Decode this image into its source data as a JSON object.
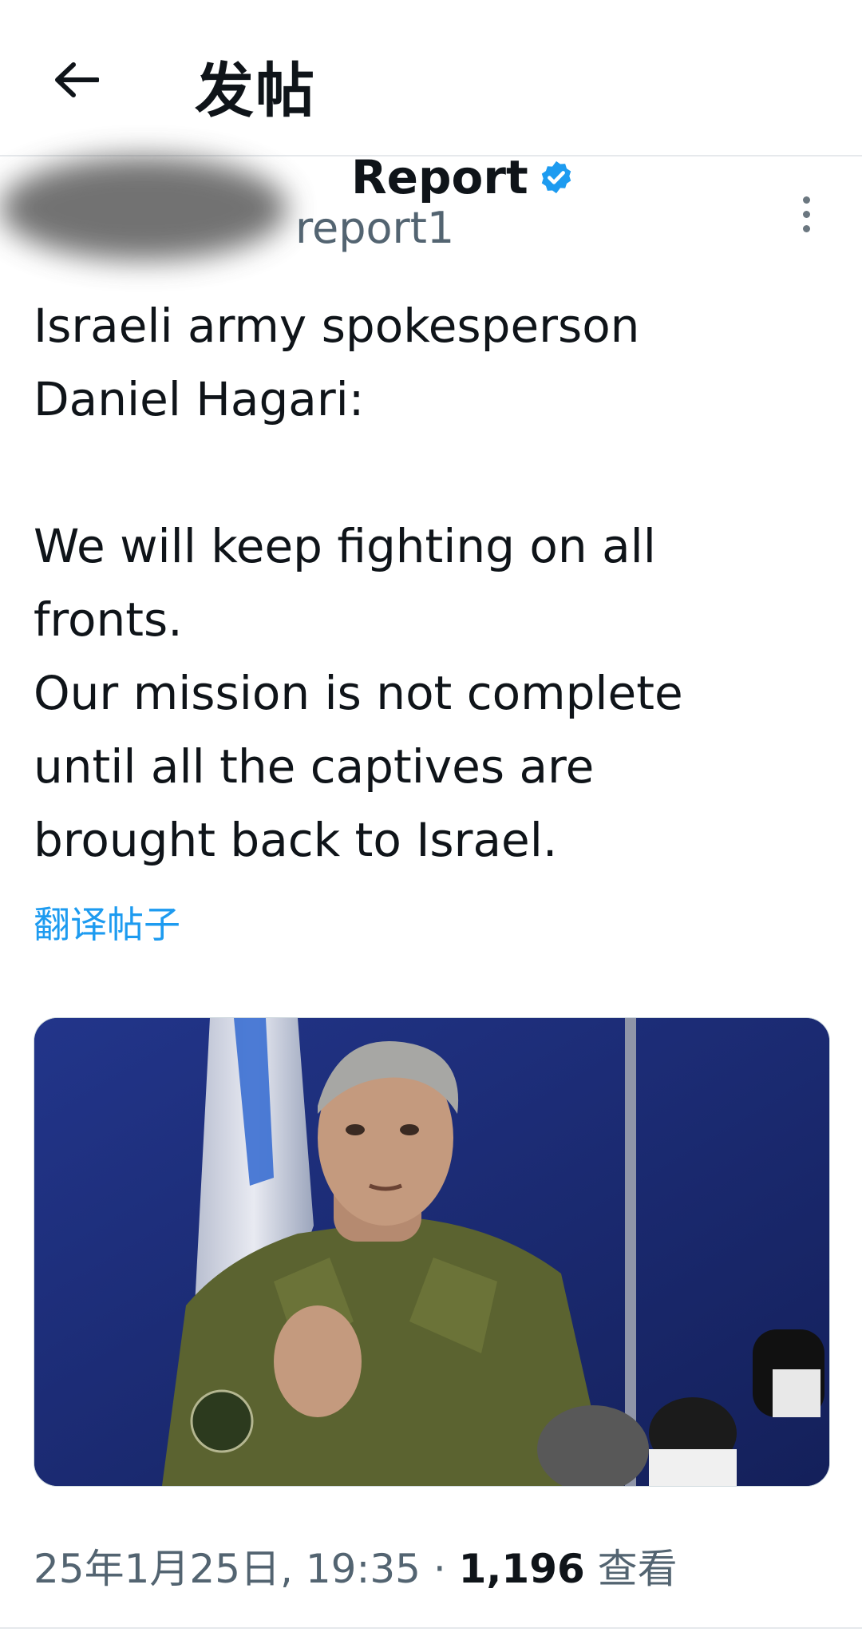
{
  "header": {
    "title": "发帖"
  },
  "author": {
    "name": "Report",
    "handle": "report1",
    "verified": true
  },
  "tweet": {
    "text": "Israeli army spokesperson\nDaniel Hagari:\n\nWe will keep fighting on all\nfronts.\nOur mission is not complete\nuntil all the captives are\nbrought back to Israel.",
    "translate_label": "翻译帖子"
  },
  "meta": {
    "timestamp": "25年1月25日, 19:35",
    "separator": " · ",
    "views_count": "1,196",
    "views_label": " 查看"
  },
  "icons": {
    "back": "arrow-left-icon",
    "verified": "verified-badge-icon",
    "more": "more-vertical-icon"
  },
  "colors": {
    "accent": "#1d9bf0",
    "secondary_text": "#536471"
  }
}
